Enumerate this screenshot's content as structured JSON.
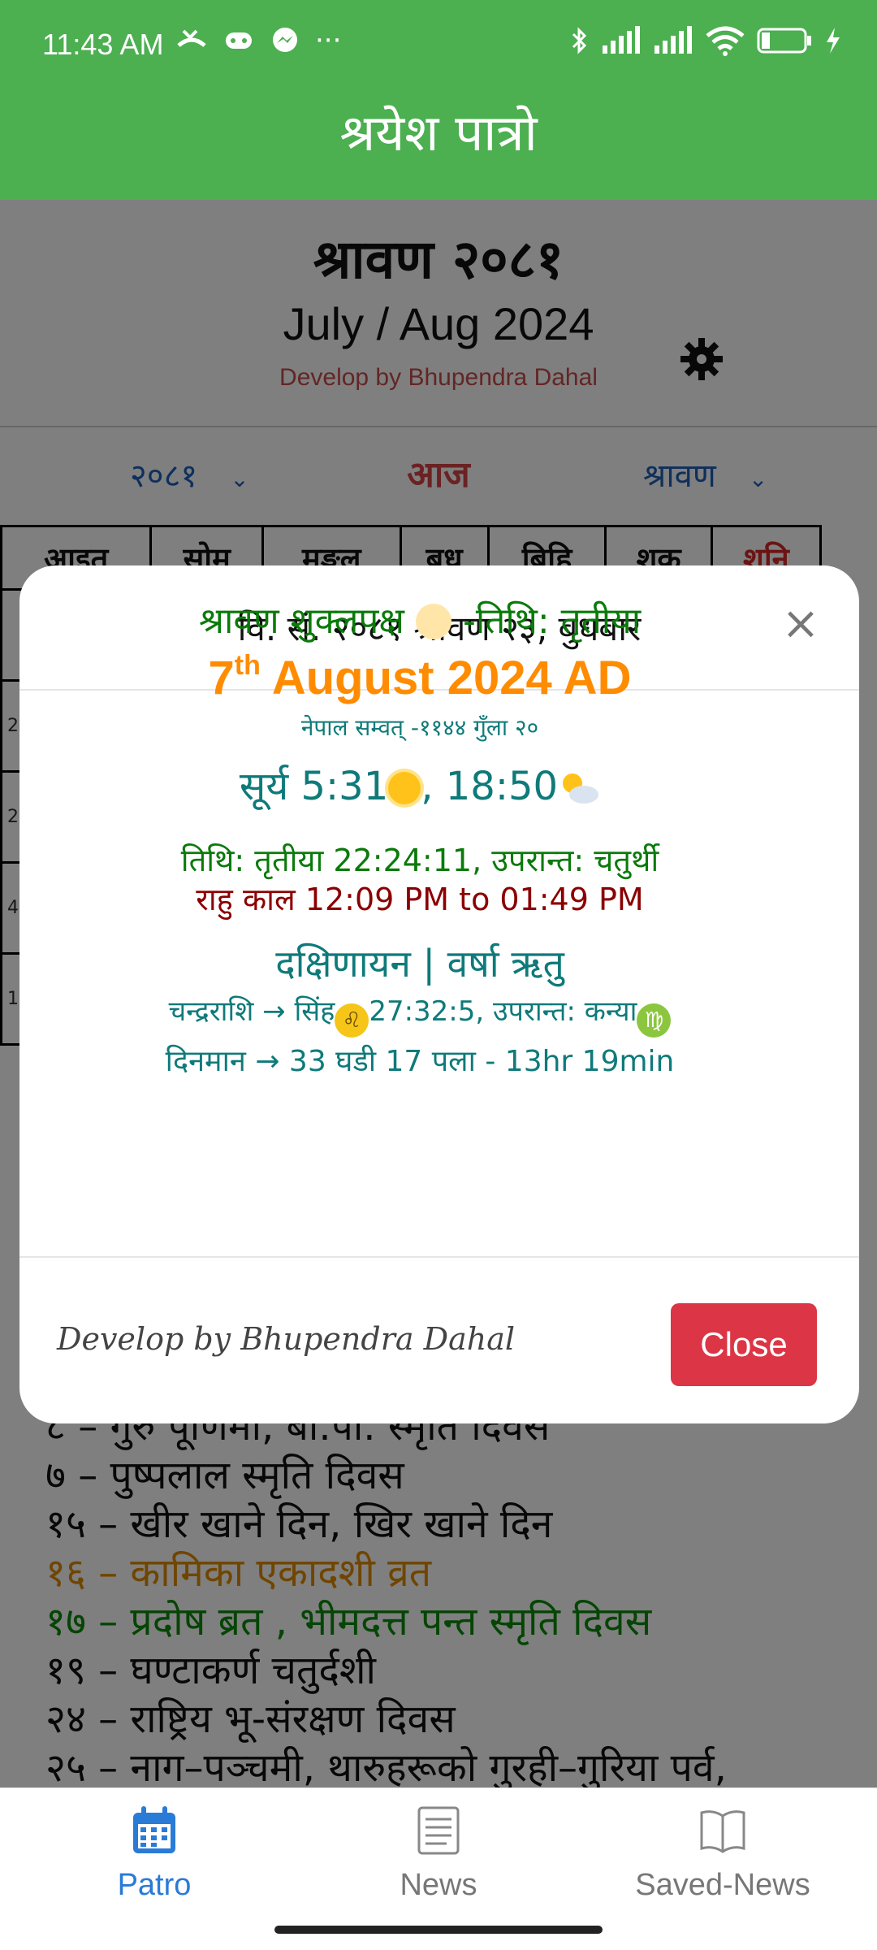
{
  "status_bar": {
    "time": "11:43 AM",
    "more": "···",
    "battery": "7"
  },
  "app": {
    "title": "श्रयेश पात्रो"
  },
  "calendar_page": {
    "month_nepali": "श्रावण २०८१",
    "month_english": "July / Aug 2024",
    "developer_credit": "Develop by Bhupendra Dahal",
    "year_select": "२०८१",
    "today_label": "आज",
    "month_select": "श्रावण",
    "weekdays": [
      "आइत",
      "सोम",
      "मङ्गल",
      "बुध",
      "बिहि",
      "शुक्र",
      "शनि"
    ],
    "row_hints": [
      "",
      "2",
      "2",
      "4",
      "11"
    ],
    "events": [
      {
        "text": "८ – गुरु पूर्णिमा, बी.पी. स्मृति दिवस",
        "style": "normal"
      },
      {
        "text": "७ – पुष्पलाल स्मृति दिवस",
        "style": "normal"
      },
      {
        "text": "१५ – खीर खाने दिन, खिर खाने दिन",
        "style": "normal"
      },
      {
        "text": "१६ – कामिका एकादशी व्रत",
        "style": "orange"
      },
      {
        "text": "१७ – प्रदोष ब्रत , भीमदत्त पन्त स्मृति दिवस",
        "style": "green"
      },
      {
        "text": "१९ – घण्टाकर्ण चतुर्दशी",
        "style": "normal"
      },
      {
        "text": "२४ – राष्ट्रिय भू-संरक्षण दिवस",
        "style": "normal"
      },
      {
        "text": "२५ – नाग–पञ्चमी, थारुहरूको गुरही–गुरिया पर्व,",
        "style": "normal"
      }
    ]
  },
  "modal": {
    "title": "वि. सं. २०८१ श्रावण २३, बुधबार",
    "close_x": "×",
    "paksha_left": "श्रावण शुक्लपक्ष",
    "paksha_right": "-तिथि: तृतीया",
    "date_day": "7",
    "date_suffix": "th",
    "date_rest": " August 2024 AD",
    "nepal_samvat": "नेपाल सम्वत् -११४४ गुँला २०",
    "sun_prefix": "सूर्य 5:31",
    "sun_sep": ", 18:50",
    "tithi_line": "तिथि: तृतीया 22:24:11, उपरान्त: चतुर्थी",
    "rahu_line": "राहु काल 12:09 PM to 01:49 PM",
    "ayan_line": "दक्षिणायन | वर्षा ऋतु",
    "rashi_prefix": "चन्द्रराशि → सिंह",
    "rashi_mid": "27:32:5, उपरान्त: कन्या",
    "dinman_line": "दिनमान → 33 घडी 17 पला - 13hr 19min",
    "footer_credit": "Develop by Bhupendra Dahal",
    "close_button": "Close"
  },
  "bottom_nav": [
    {
      "label": "Patro",
      "icon": "calendar-icon",
      "active": true
    },
    {
      "label": "News",
      "icon": "newspaper-icon",
      "active": false
    },
    {
      "label": "Saved-News",
      "icon": "book-icon",
      "active": false
    }
  ]
}
